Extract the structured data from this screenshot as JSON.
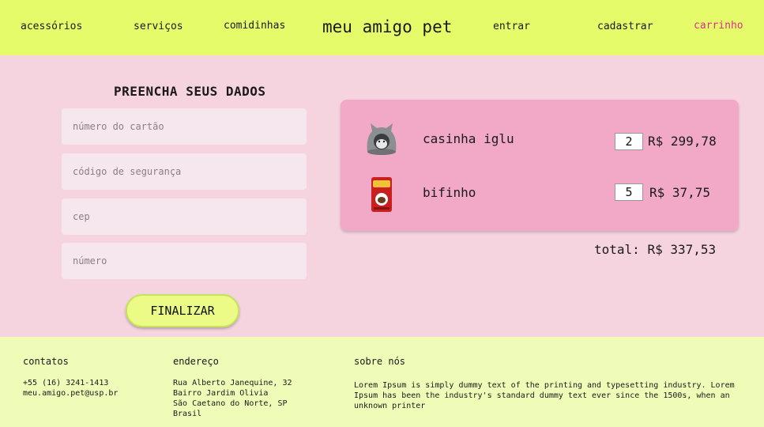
{
  "header": {
    "nav_left": [
      "acessórios",
      "serviços",
      "comidinhas"
    ],
    "brand": "meu amigo pet",
    "nav_right": [
      "entrar",
      "cadastrar",
      "carrinho"
    ]
  },
  "form": {
    "title": "PREENCHA SEUS DADOS",
    "fields": [
      {
        "placeholder": "número do cartão"
      },
      {
        "placeholder": "código de segurança"
      },
      {
        "placeholder": "cep"
      },
      {
        "placeholder": "número"
      }
    ],
    "submit_label": "FINALIZAR"
  },
  "cart": {
    "items": [
      {
        "name": "casinha iglu",
        "qty": "2",
        "price": "R$ 299,78",
        "icon": "cat-igloo-bed-icon"
      },
      {
        "name": "bifinho",
        "qty": "5",
        "price": "R$ 37,75",
        "icon": "treat-bag-icon"
      }
    ],
    "total_label": "total:",
    "total_value": "R$ 337,53"
  },
  "footer": {
    "contacts": {
      "title": "contatos",
      "lines": [
        "+55 (16) 3241-1413",
        "meu.amigo.pet@usp.br"
      ]
    },
    "address": {
      "title": "endereço",
      "lines": [
        "Rua Alberto Janequine, 32",
        "Bairro Jardim Olivia",
        "São Caetano do Norte, SP",
        "Brasil"
      ]
    },
    "about": {
      "title": "sobre nós",
      "lines": [
        "Lorem Ipsum is simply dummy text of the printing and typesetting industry. Lorem",
        "Ipsum has been the industry's standard dummy text ever since the 1500s, when an",
        "unknown printer"
      ]
    }
  },
  "colors": {
    "header_bg": "#e6fb6a",
    "main_bg": "#f5d3df",
    "cart_bg": "#f2a9c8",
    "footer_bg": "#eefcb8",
    "accent": "#d6338a"
  }
}
